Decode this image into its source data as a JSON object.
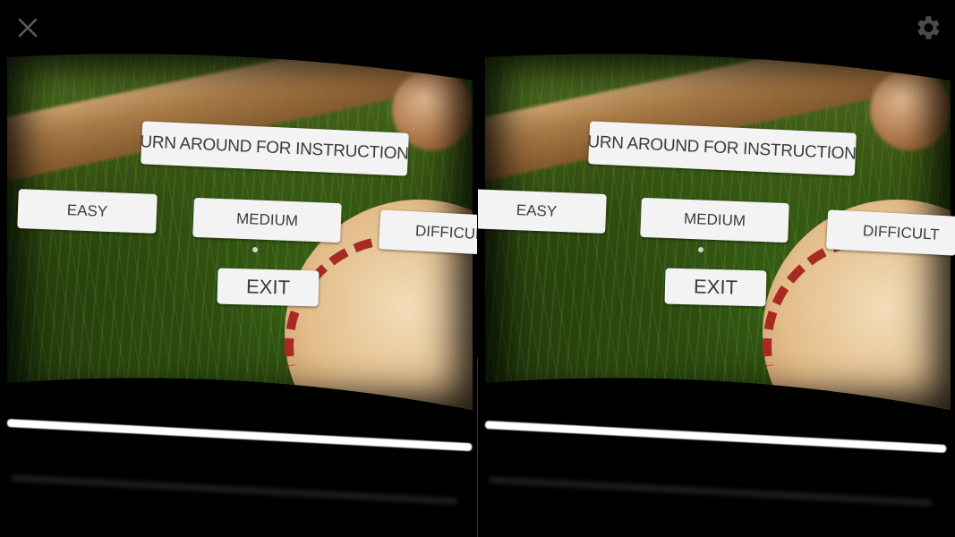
{
  "toolbar": {
    "close_icon": "close-icon",
    "settings_icon": "gear-icon"
  },
  "menu": {
    "title": "TURN AROUND FOR INSTRUCTIONS",
    "easy": "EASY",
    "medium": "MEDIUM",
    "difficult": "DIFFICULT",
    "exit": "EXIT"
  },
  "scene": {
    "background": "baseball and bat on grass",
    "view_mode": "stereoscopic VR split-screen"
  }
}
